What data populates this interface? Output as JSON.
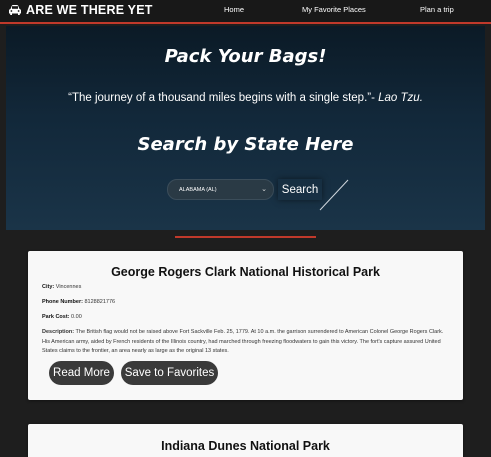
{
  "nav": {
    "brand": "ARE WE THERE YET",
    "links": [
      "Home",
      "My Favorite Places",
      "Plan a trip"
    ]
  },
  "hero": {
    "title": "Pack Your Bags!",
    "quote": "“The journey of a thousand miles begins with a single step.”- ",
    "quote_author": "Lao Tzu.",
    "search_title": "Search by State Here",
    "state_selected": "ALABAMA (AL)",
    "search_button": "Search"
  },
  "parks": [
    {
      "name": "George Rogers Clark National Historical Park",
      "city_label": "City:",
      "city": "Vincennes",
      "phone_label": "Phone Number:",
      "phone": "8128821776",
      "cost_label": "Park Cost:",
      "cost": "0.00",
      "desc_label": "Description:",
      "description": "The British flag would not be raised above Fort Sackville Feb. 25, 1779. At 10 a.m. the garrison surrendered to American Colonel George Rogers Clark. His American army, aided by French residents of the Illinois country, had marched through freezing floodwaters to gain this victory. The fort's capture assured United States claims to the frontier, an area nearly as large as the original 13 states.",
      "read_more": "Read More",
      "save": "Save to Favorites"
    },
    {
      "name": "Indiana Dunes National Park"
    }
  ],
  "colors": {
    "accent": "#c0392b",
    "card_bg": "#f8f8f8",
    "button_bg": "#3a3a3a"
  }
}
